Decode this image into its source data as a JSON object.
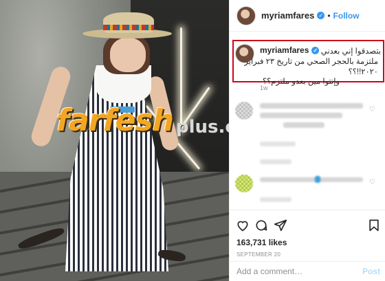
{
  "post": {
    "username": "myriamfares",
    "follow_label": "Follow",
    "separator": "•",
    "caption_lines": [
      "بتصدقوا إني بعدني",
      "ملتزمة بالحجر الصحي من تاريخ ٢٣ فبراير",
      "٢٠٢٠!!؟؟",
      "وإنتوا مين بعدو ملتزم؟؟"
    ],
    "time_ago": "1w",
    "likes": "163,731 likes",
    "date": "SEPTEMBER 20",
    "comment_placeholder": "Add a comment…",
    "post_label": "Post"
  },
  "watermark": {
    "brand": "farfesh",
    "suffix": "plus.com"
  },
  "icons": {
    "verified": "verified-badge-icon",
    "like": "heart-icon",
    "comment": "comment-bubble-icon",
    "share": "paper-plane-icon",
    "save": "bookmark-icon"
  },
  "colors": {
    "accent": "#3897f0",
    "highlight_box": "#d0021b",
    "watermark": "#f2a623"
  }
}
